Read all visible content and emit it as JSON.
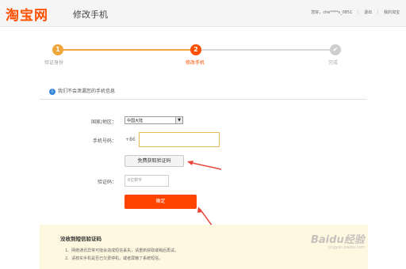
{
  "header": {
    "logo": "淘宝网",
    "title": "修改手机",
    "user": "您好，che****s_0851",
    "logout": "退出",
    "my_taobao": "我的淘宝"
  },
  "steps": [
    {
      "num": "1",
      "label": "验证身份"
    },
    {
      "num": "2",
      "label": "修改手机"
    },
    {
      "num": "✔",
      "label": "完成"
    }
  ],
  "info": {
    "text": "我们不会泄漏您的手机信息"
  },
  "form": {
    "country_label": "国家/地区：",
    "country_value": "中国大陆",
    "phone_label": "手机号码：",
    "phone_prefix": "+86",
    "phone_value": "",
    "send_code_label": "免费获取验证码",
    "code_label": "验证码：",
    "code_placeholder": "6位数字",
    "confirm_label": "确定"
  },
  "notice": {
    "title": "没收到短信验证码",
    "items": [
      "1、网络通讯异常可能会造成短信丢失，请重新获取或稍后再试。",
      "2、请核实手机是否已欠费停机，或者屏蔽了系统短信。"
    ]
  },
  "colors": {
    "accent": "#ff5000",
    "step_done": "#f2a53a",
    "confirm": "#ff4400",
    "annotation_arrow": "#e8463a"
  },
  "watermark": {
    "brand": "Baidu经验",
    "url": "jingyan.baidu.com"
  }
}
